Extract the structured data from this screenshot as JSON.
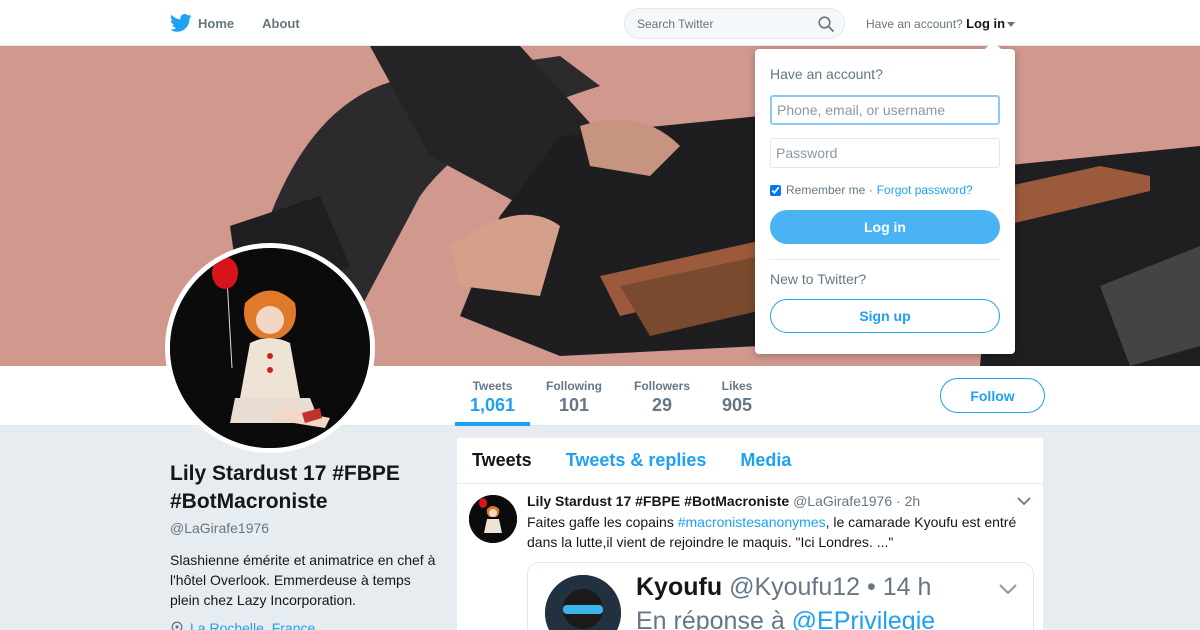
{
  "nav": {
    "home_label": "Home",
    "about_label": "About",
    "search_placeholder": "Search Twitter",
    "have_account": "Have an account?",
    "login_label": "Log in"
  },
  "profile": {
    "name": "Lily Stardust 17 #FBPE #BotMacroniste",
    "screen_name": "@LaGirafe1976",
    "bio": "Slashienne émérite et animatrice en chef à l'hôtel Overlook. Emmerdeuse à temps plein chez Lazy Incorporation.",
    "location": "La Rochelle, France"
  },
  "stats": [
    {
      "label": "Tweets",
      "value": "1,061"
    },
    {
      "label": "Following",
      "value": "101"
    },
    {
      "label": "Followers",
      "value": "29"
    },
    {
      "label": "Likes",
      "value": "905"
    }
  ],
  "follow_label": "Follow",
  "timeline": {
    "tabs": [
      "Tweets",
      "Tweets & replies",
      "Media"
    ],
    "tweet": {
      "fullname": "Lily Stardust 17 #FBPE #BotMacroniste",
      "screen_name": "@LaGirafe1976",
      "time": "· 2h",
      "text_before": "Faites gaffe les copains ",
      "hashtag": "#macronistesanonymes",
      "text_after": ",  le camarade Kyoufu est entré dans la lutte,il vient de rejoindre le maquis. \"Ici Londres. ...\"",
      "quote": {
        "name": "Kyoufu",
        "handle_time": "@Kyoufu12 • 14 h",
        "reply_prefix": "En réponse à ",
        "reply_to": "@EPrivilegie"
      }
    }
  },
  "login_dropdown": {
    "title": "Have an account?",
    "username_placeholder": "Phone, email, or username",
    "password_placeholder": "Password",
    "remember_label": "Remember me ·",
    "forgot_label": "Forgot password?",
    "login_button": "Log in",
    "new_label": "New to Twitter?",
    "signup_button": "Sign up"
  },
  "colors": {
    "accent": "#1da1f2",
    "login_button": "#4ab3f4",
    "background": "#e6ecf0"
  }
}
